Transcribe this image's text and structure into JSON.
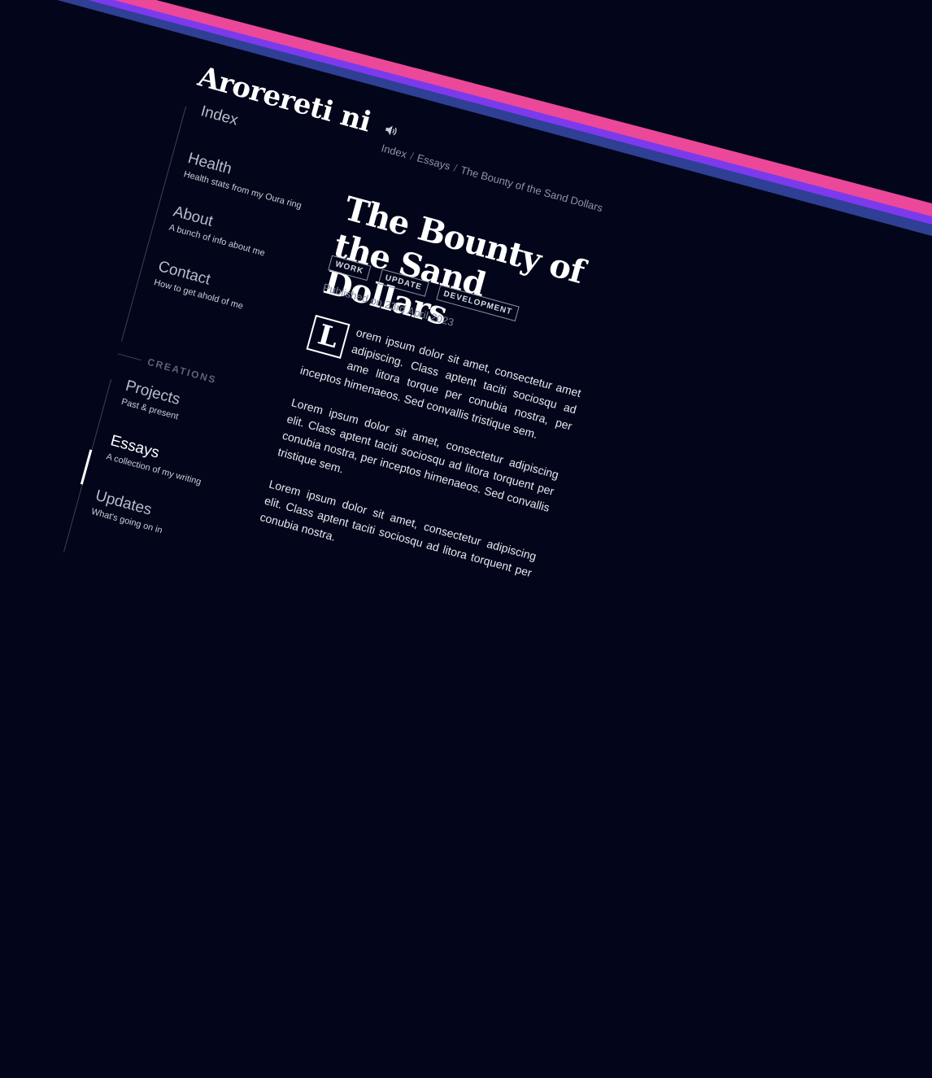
{
  "colors": {
    "background": "#03061a",
    "stripe_pink": "#ec4899",
    "stripe_purple": "#7c3aed",
    "stripe_blue": "#2e3f94"
  },
  "site": {
    "logo": "Arorereti ni",
    "logo_text": "Arorereti ni",
    "speaker_icon": "speaker-icon"
  },
  "breadcrumb": [
    "Index",
    "Essays",
    "The Bounty of the Sand Dollars"
  ],
  "nav": {
    "index": {
      "title": "Index"
    },
    "health": {
      "title": "Health",
      "subtitle": "Health stats from my Oura ring"
    },
    "about": {
      "title": "About",
      "subtitle": "A bunch of info about me"
    },
    "contact": {
      "title": "Contact",
      "subtitle": "How to get ahold of me"
    },
    "section_label": "CREATIONS",
    "projects": {
      "title": "Projects",
      "subtitle": "Past & present"
    },
    "essays": {
      "title": "Essays",
      "subtitle": "A collection of my writing"
    },
    "updates": {
      "title": "Updates",
      "subtitle": "What's going on in"
    }
  },
  "article": {
    "title": "The Bounty of the Sand Dollars",
    "tags": [
      "WORK",
      "UPDATE",
      "DEVELOPMENT"
    ],
    "published": "Published on 23rd April 2023",
    "dropcap": "L",
    "p1_rest": "orem ipsum dolor sit amet, consectetur amet adipiscing. Class aptent taciti sociosqu ad ame litora torque per conubia nostra, per inceptos himenaeos. Sed convallis tristique sem.",
    "p2": "Lorem ipsum dolor sit amet, consectetur adipiscing elit. Class aptent taciti sociosqu ad litora torquent per conubia nostra, per inceptos himenaeos. Sed convallis tristique sem.",
    "p3": "Lorem ipsum dolor sit amet, consectetur adipiscing elit. Class aptent taciti sociosqu ad litora torquent per conubia nostra."
  }
}
